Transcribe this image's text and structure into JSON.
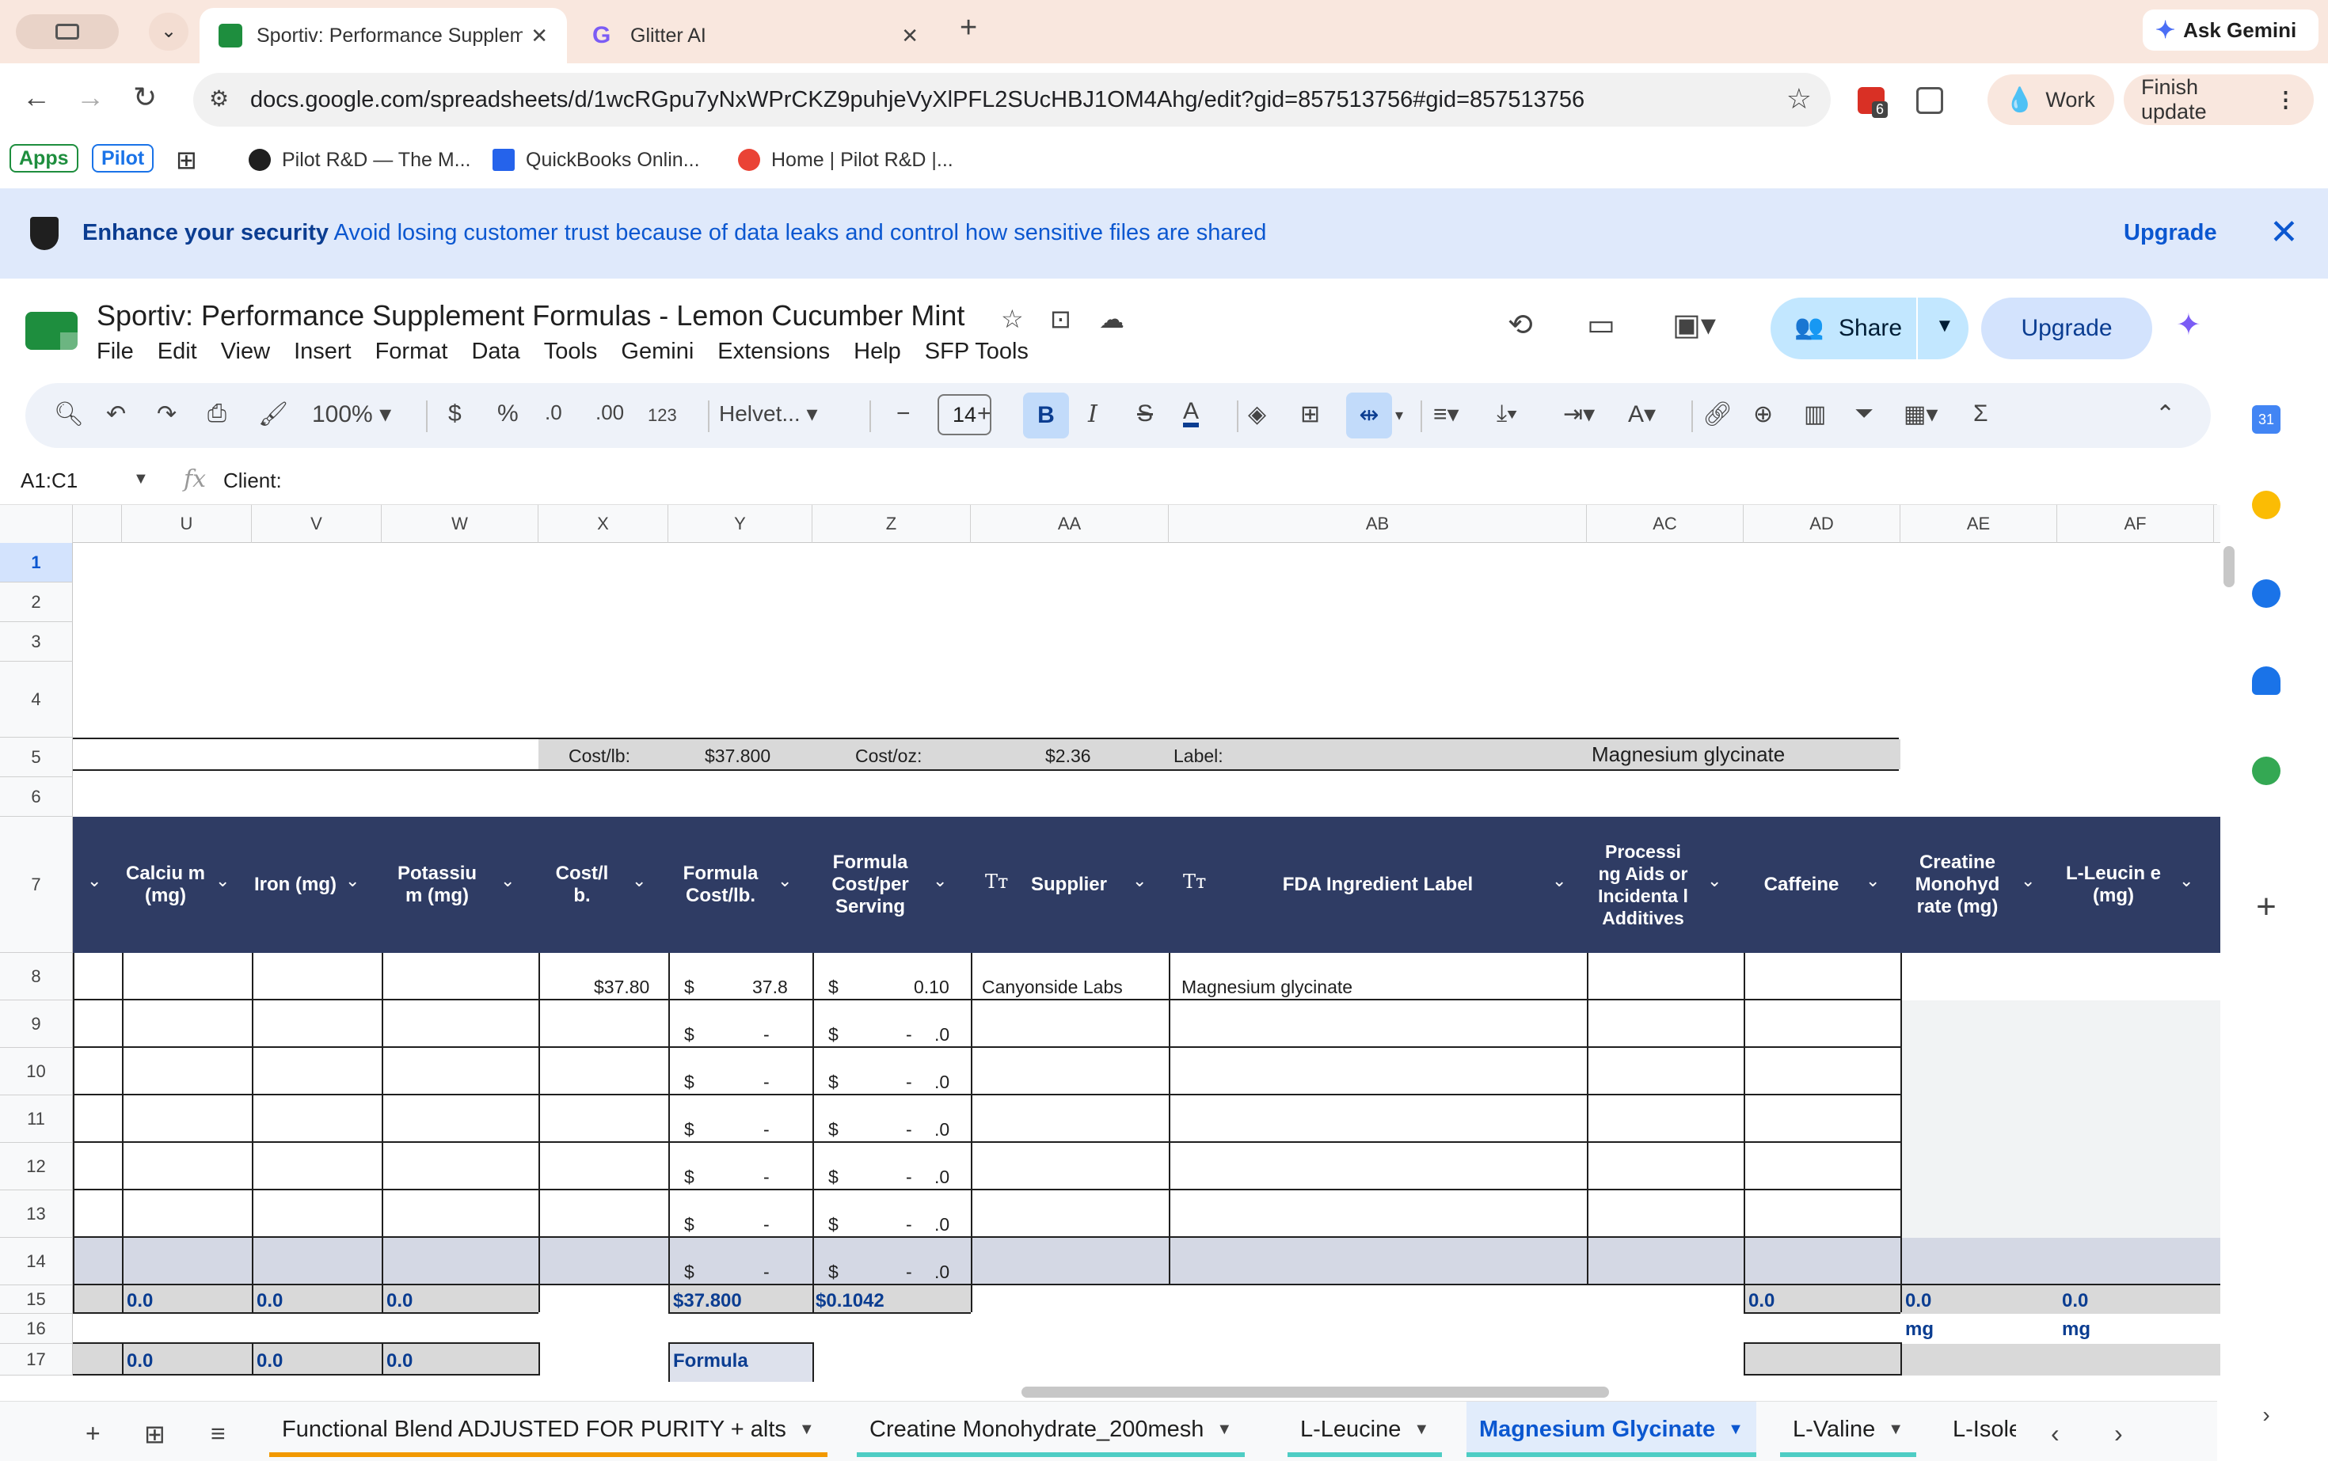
{
  "browser": {
    "tabs": [
      {
        "title": "Sportiv: Performance Supplemen",
        "close": "✕"
      },
      {
        "title": "Glitter AI",
        "close": "✕"
      }
    ],
    "new_tab": "+",
    "ask_gemini": "Ask Gemini",
    "url": "docs.google.com/spreadsheets/d/1wcRGpu7yNxWPrCKZ9puhjeVyXlPFL2SUcHBJ1OM4Ahg/edit?gid=857513756#gid=857513756",
    "extension_badge": "6",
    "profile": "Work",
    "finish_update": "Finish update"
  },
  "bookmarks": [
    {
      "label": "Apps"
    },
    {
      "label": "Pilot"
    },
    {
      "label": "Pilot R&D — The M..."
    },
    {
      "label": "QuickBooks Onlin..."
    },
    {
      "label": "Home | Pilot R&D |..."
    }
  ],
  "banner": {
    "bold": "Enhance your security",
    "text": "Avoid losing customer trust because of data leaks and control how sensitive files are shared",
    "upgrade": "Upgrade"
  },
  "doc": {
    "title": "Sportiv: Performance Supplement Formulas - Lemon Cucumber Mint",
    "menu": [
      "File",
      "Edit",
      "View",
      "Insert",
      "Format",
      "Data",
      "Tools",
      "Gemini",
      "Extensions",
      "Help",
      "SFP Tools"
    ],
    "share": "Share",
    "upgrade": "Upgrade"
  },
  "toolbar": {
    "zoom": "100%",
    "currency": "$",
    "percent": "%",
    "dec_less": ".0",
    "dec_more": ".00",
    "number_format": "123",
    "font": "Helvet...",
    "font_size": "14"
  },
  "formula_bar": {
    "name_box": "A1:C1",
    "fx": "fx",
    "content": "Client:"
  },
  "grid": {
    "columns": [
      "U",
      "V",
      "W",
      "X",
      "Y",
      "Z",
      "AA",
      "AB",
      "AC",
      "AD",
      "AE",
      "AF"
    ],
    "rows": [
      "1",
      "2",
      "3",
      "4",
      "5",
      "6",
      "7",
      "8",
      "9",
      "10",
      "11",
      "12",
      "13",
      "14",
      "15",
      "16",
      "17"
    ],
    "row5": {
      "cost_lb_label": "Cost/lb:",
      "cost_lb_value": "$37.800",
      "cost_oz_label": "Cost/oz:",
      "cost_oz_value": "$2.36",
      "label_label": "Label:",
      "label_value": "Magnesium glycinate"
    },
    "headers": {
      "calcium": "Calciu m (mg)",
      "iron": "Iron (mg)",
      "potassium": "Potassiu m (mg)",
      "cost_lb": "Cost/l b.",
      "formula_cost_lb": "Formula Cost/lb.",
      "formula_cost_serving": "Formula Cost/per Serving",
      "supplier": "Supplier",
      "fda_label": "FDA Ingredient Label",
      "processing": "Processi ng Aids or Incidenta l Additives",
      "caffeine": "Caffeine",
      "creatine": "Creatine Monohyd rate (mg)",
      "leucine": "L-Leucin e (mg)",
      "tt": "Tт"
    },
    "row8": {
      "cost_lb": "$37.80",
      "dollar": "$",
      "formula_cost_lb": "37.8",
      "formula_cost_serving": "0.10",
      "supplier": "Canyonside Labs",
      "fda_label": "Magnesium glycinate"
    },
    "empty_row": {
      "dollar": "$",
      "dash": "-",
      "dec": ".0"
    },
    "row15": {
      "calcium": "0.0",
      "iron": "0.0",
      "potassium": "0.0",
      "formula_cost_lb": "$37.800",
      "formula_cost_serving": "$0.1042",
      "caffeine": "0.0",
      "creatine": "0.0",
      "leucine": "0.0"
    },
    "row16": {
      "creatine_unit": "mg",
      "leucine_unit": "mg"
    },
    "row17": {
      "calcium": "0.0",
      "iron": "0.0",
      "potassium": "0.0",
      "formula_label": "Formula"
    }
  },
  "sheet_tabs": [
    {
      "label": "Functional Blend ADJUSTED FOR PURITY + alts"
    },
    {
      "label": "Creatine Monohydrate_200mesh"
    },
    {
      "label": "L-Leucine"
    },
    {
      "label": "Magnesium Glycinate"
    },
    {
      "label": "L-Valine"
    },
    {
      "label": "L-Isole"
    }
  ],
  "colors": {
    "header_band": "#2f3c64",
    "accent_blue": "#0b57d0",
    "tab_strip": "#f9e7de"
  }
}
